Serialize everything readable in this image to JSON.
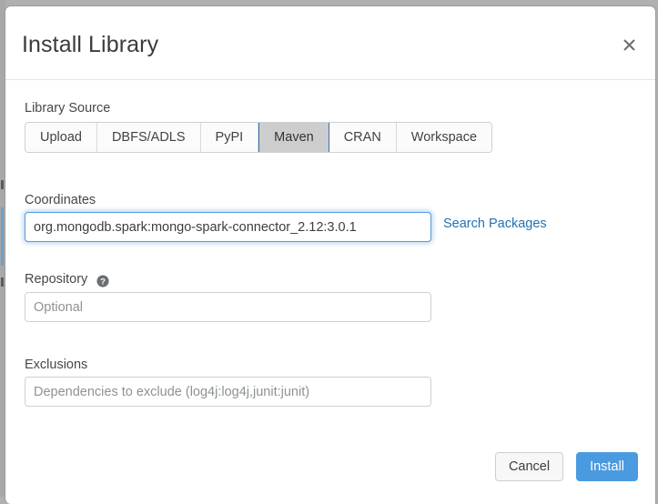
{
  "dialog": {
    "title": "Install Library",
    "close_icon": "close-icon"
  },
  "library_source": {
    "label": "Library Source",
    "tabs": [
      {
        "label": "Upload",
        "selected": false
      },
      {
        "label": "DBFS/ADLS",
        "selected": false
      },
      {
        "label": "PyPI",
        "selected": false
      },
      {
        "label": "Maven",
        "selected": true
      },
      {
        "label": "CRAN",
        "selected": false
      },
      {
        "label": "Workspace",
        "selected": false
      }
    ],
    "selected_tab": "Maven"
  },
  "coordinates": {
    "label": "Coordinates",
    "value": "org.mongodb.spark:mongo-spark-connector_2.12:3.0.1",
    "placeholder": "",
    "focused": true,
    "search_link": "Search Packages"
  },
  "repository": {
    "label": "Repository",
    "help_icon": "help-circle-icon",
    "value": "",
    "placeholder": "Optional"
  },
  "exclusions": {
    "label": "Exclusions",
    "value": "",
    "placeholder": "Dependencies to exclude (log4j:log4j,junit:junit)"
  },
  "footer": {
    "cancel_label": "Cancel",
    "install_label": "Install"
  },
  "colors": {
    "accent_blue": "#4a9ae0",
    "link_blue": "#2272b4",
    "selected_tab_bg": "#cdcdcd",
    "selected_tab_border": "#3b72a4",
    "focus_ring": "#5b9bd8",
    "border_gray": "#ccd0d3",
    "text_dark": "#3b3b3b",
    "placeholder_gray": "#8d9296"
  }
}
